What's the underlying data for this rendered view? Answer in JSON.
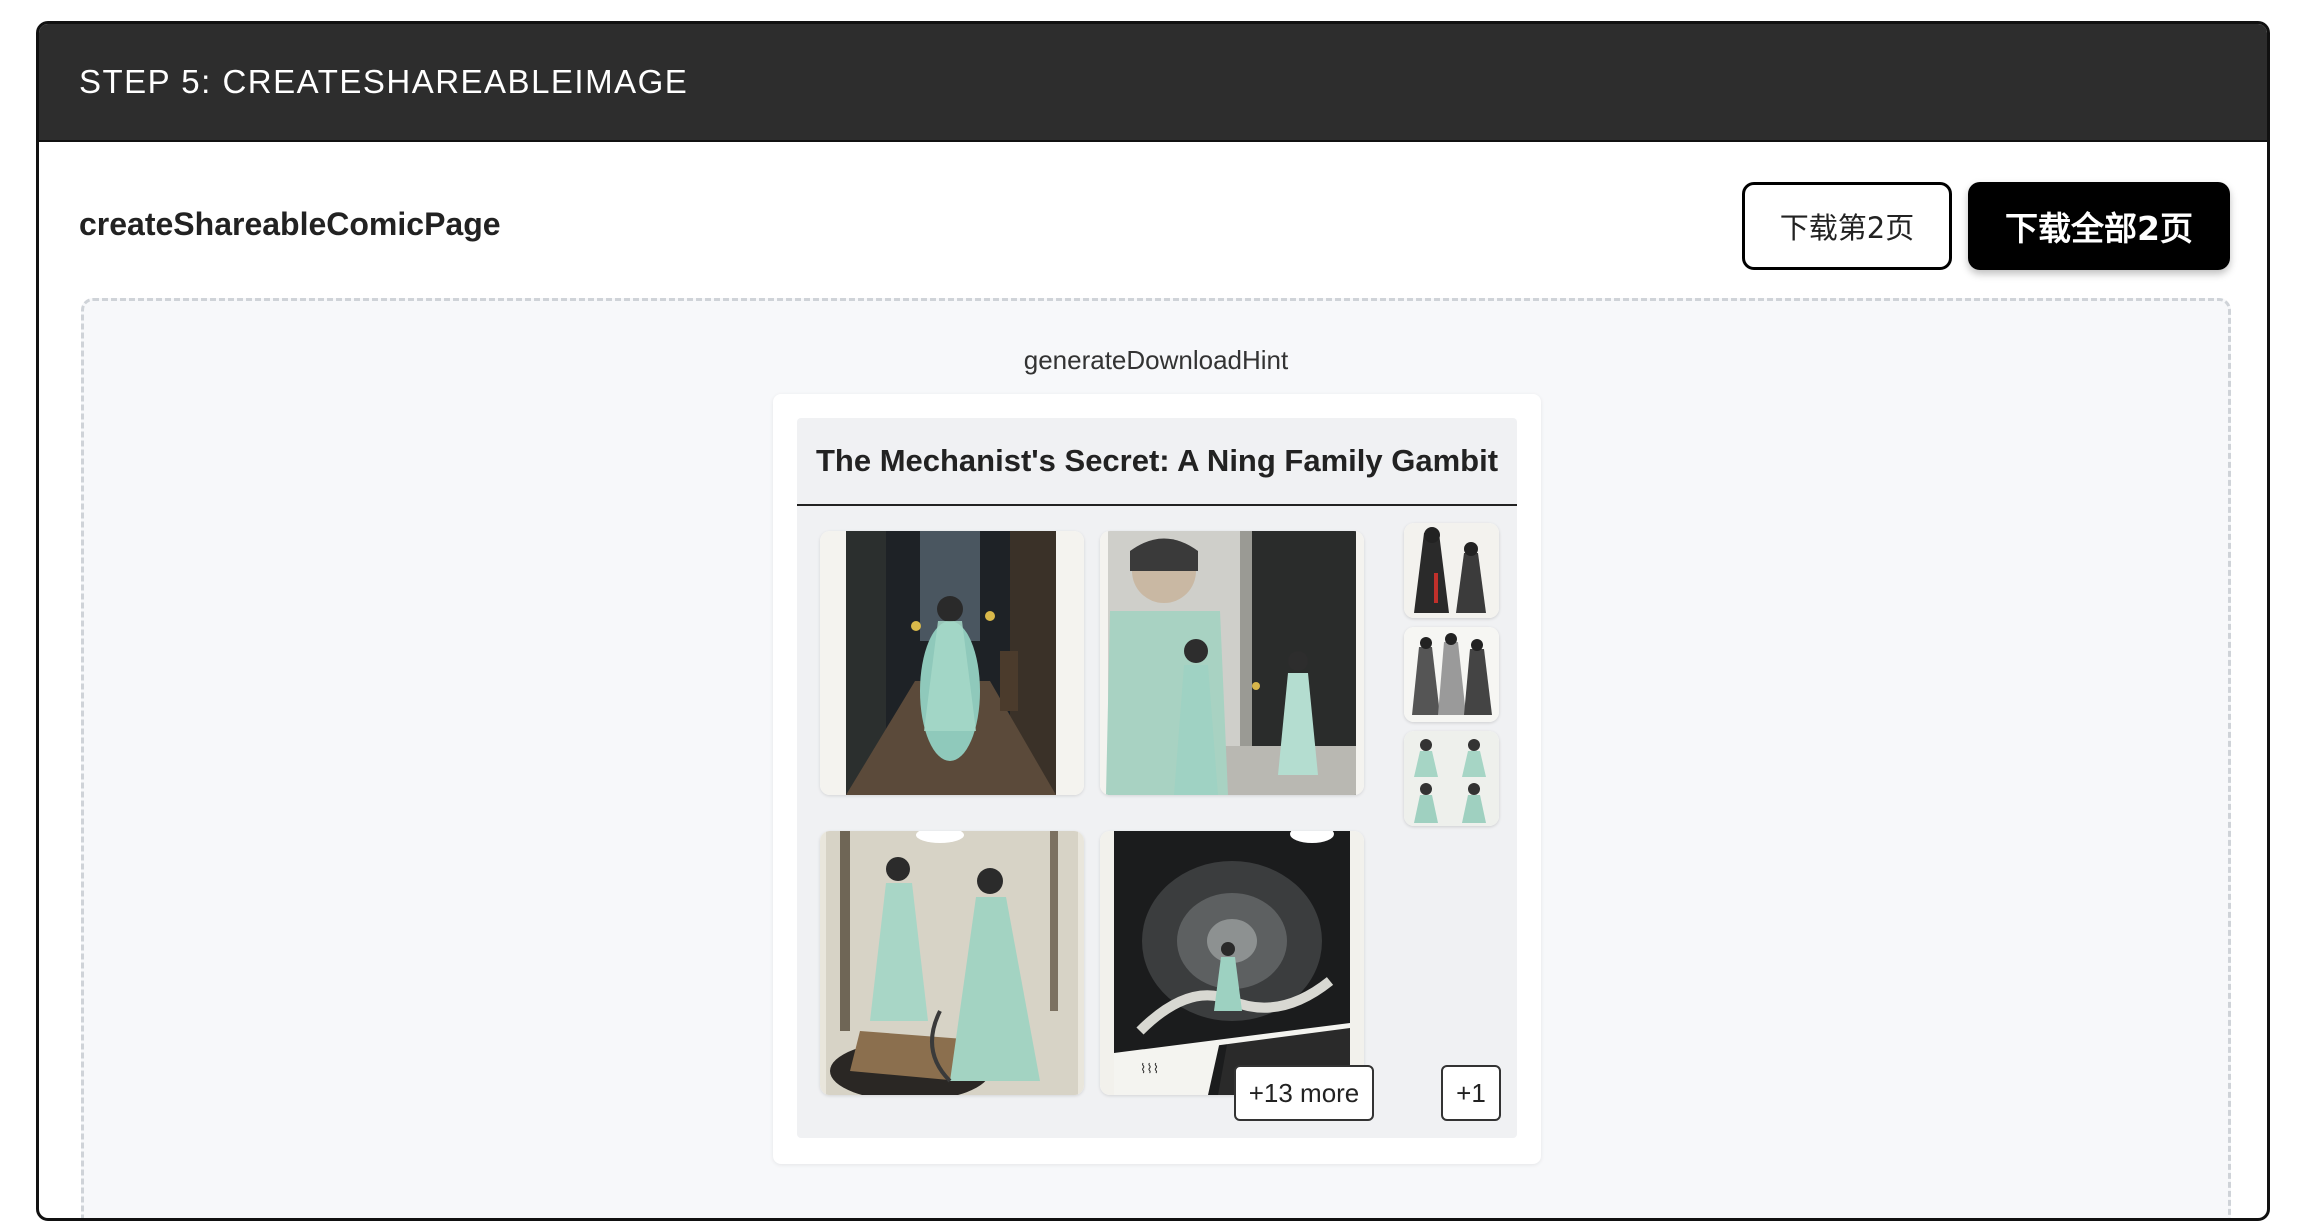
{
  "header": {
    "title": "STEP 5: CREATESHAREABLEIMAGE"
  },
  "component": {
    "name": "createShareableComicPage"
  },
  "actions": {
    "download_page_label": "下载第2页",
    "download_all_label": "下载全部2页"
  },
  "preview": {
    "hint": "generateDownloadHint",
    "comic_title": "The Mechanist's Secret: A Ning Family Gambit",
    "more_panels_label": "+13 more",
    "more_thumbs_label": "+1",
    "panels": [
      {
        "scene": "figure in robes walking down dark alley"
      },
      {
        "scene": "elder watches two figures at doorway"
      },
      {
        "scene": "two figures near glowing well"
      },
      {
        "scene": "figure in swirling dark tunnel with captions"
      }
    ],
    "thumbnails": [
      {
        "scene": "ink figures with red accents"
      },
      {
        "scene": "ink sketch group"
      },
      {
        "scene": "four figures in teal robes"
      }
    ]
  }
}
